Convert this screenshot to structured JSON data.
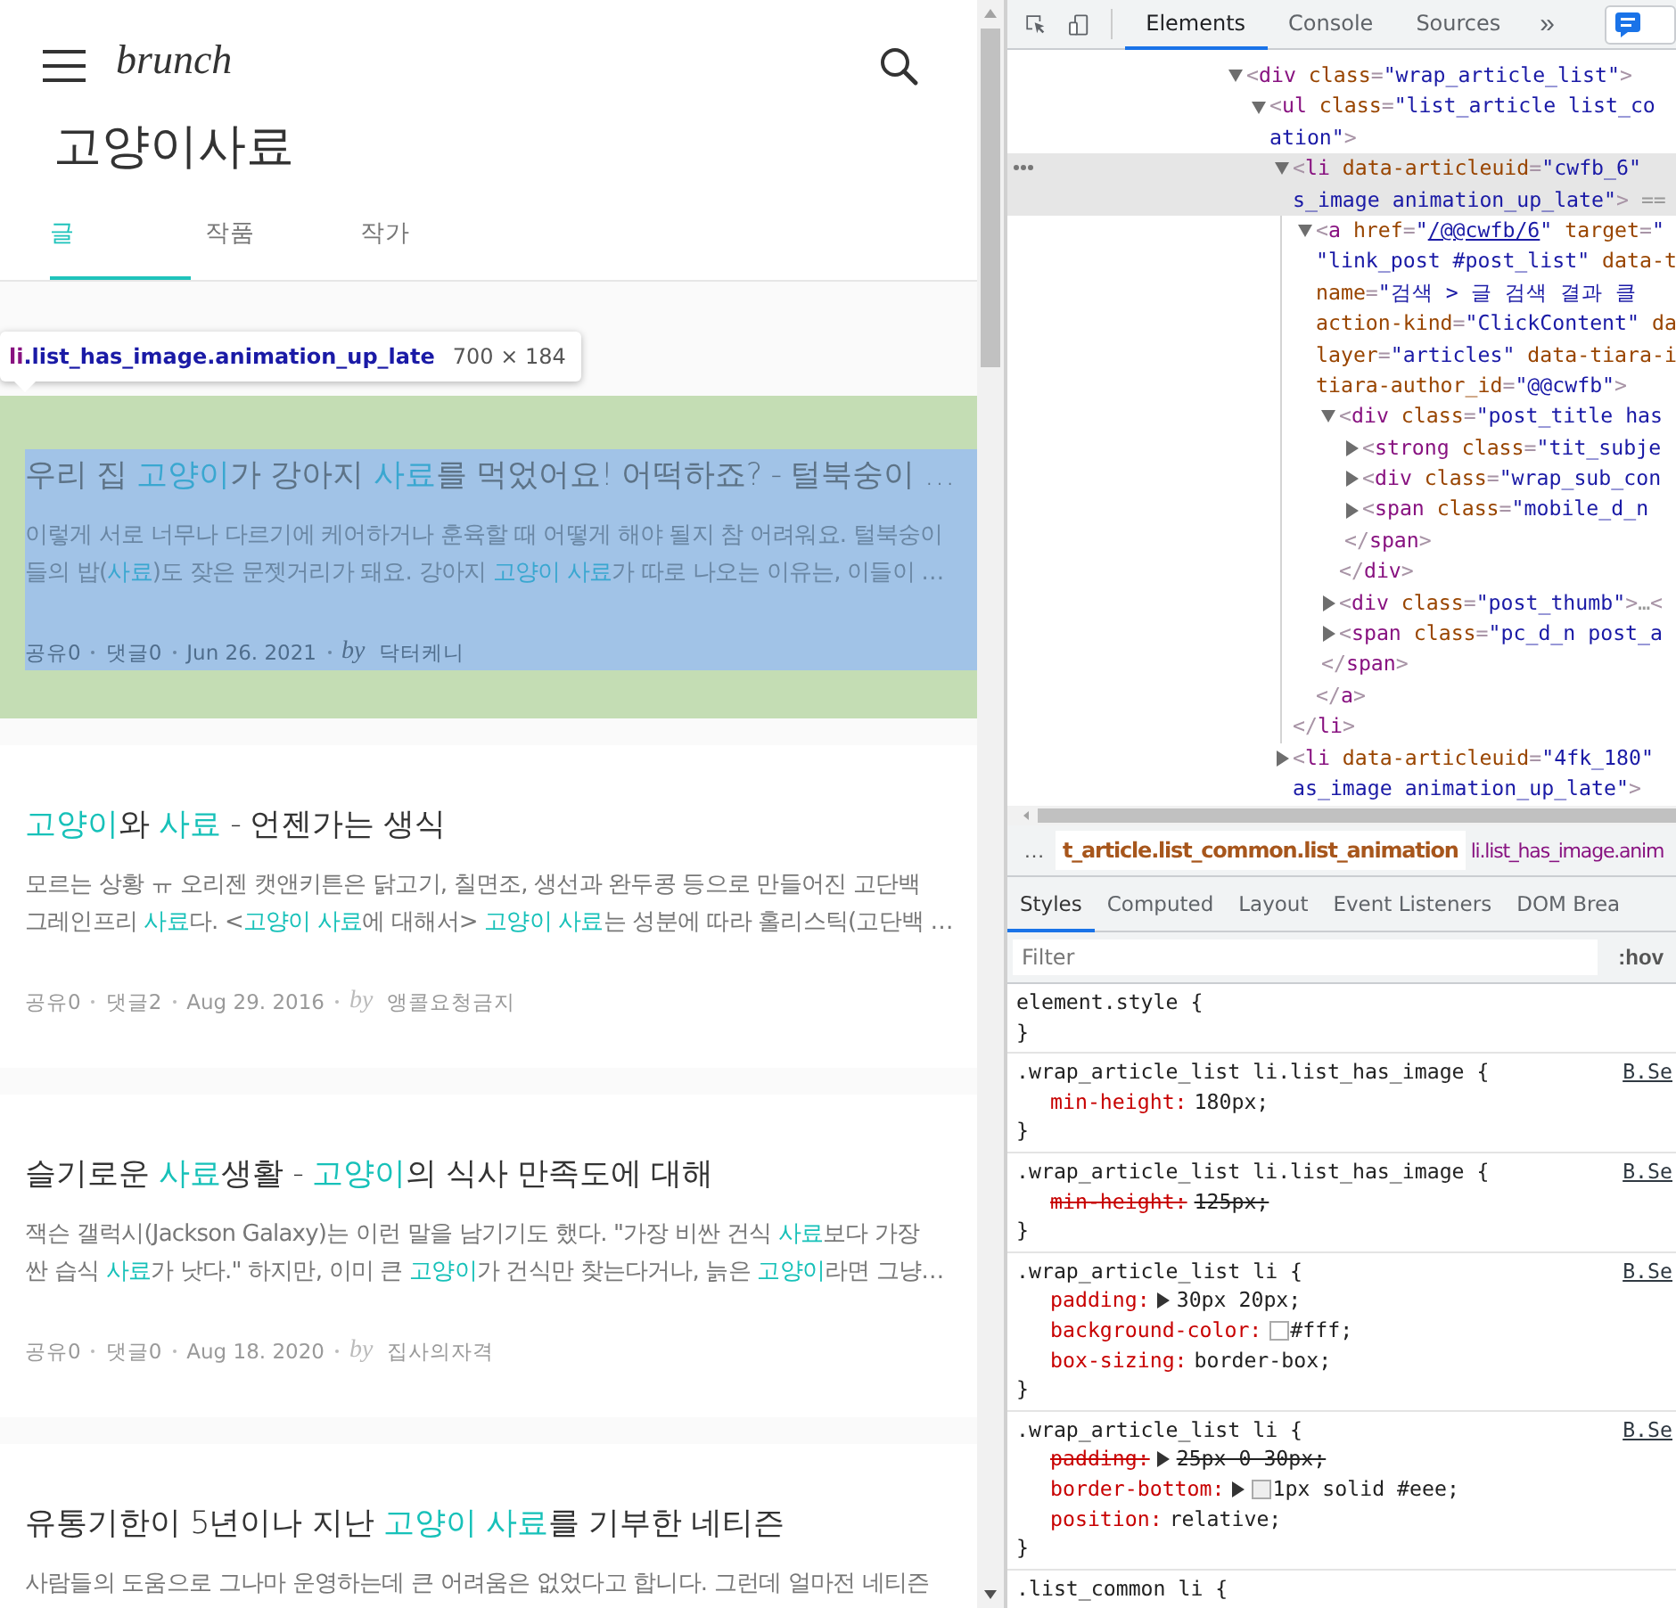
{
  "search_page": {
    "logo": "brunch",
    "query_title": "고양이사료",
    "tabs": [
      {
        "label": "글",
        "selected": true
      },
      {
        "label": "작품",
        "selected": false
      },
      {
        "label": "작가",
        "selected": false
      }
    ],
    "inspector_tooltip": {
      "tag": "li",
      "classes": ".list_has_image.animation_up_late",
      "size": "700 × 184"
    },
    "articles": [
      {
        "inspected": true,
        "title": [
          {
            "text": "우리 집 ",
            "match": false
          },
          {
            "text": "고양이",
            "match": true
          },
          {
            "text": "가 강아지 ",
            "match": false
          },
          {
            "text": "사료",
            "match": true
          },
          {
            "text": "를 먹었어요! 어떡하죠? - 털북숭이 …",
            "match": false
          }
        ],
        "excerpt": [
          [
            {
              "text": "이렇게 서로 너무나 다르기에 케어하거나 훈육할 때 어떻게 해야 될지 참 어려워요. 털북숭이",
              "match": false
            }
          ],
          [
            {
              "text": "들의 밥(",
              "match": false
            },
            {
              "text": "사료",
              "match": true
            },
            {
              "text": ")도 잦은 문젯거리가 돼요. 강아지 ",
              "match": false
            },
            {
              "text": "고양이 사료",
              "match": true
            },
            {
              "text": "가 따로 나오는 이유는, 이들이 …",
              "match": false
            }
          ]
        ],
        "meta": {
          "shares": "공유0",
          "comments": "댓글0",
          "date": "Jun 26. 2021",
          "by": "by",
          "author": "닥터케니"
        }
      },
      {
        "inspected": false,
        "title": [
          {
            "text": "고양이",
            "match": true
          },
          {
            "text": "와 ",
            "match": false
          },
          {
            "text": "사료",
            "match": true
          },
          {
            "text": " - 언젠가는 생식",
            "match": false
          }
        ],
        "excerpt": [
          [
            {
              "text": "모르는 상황 ㅠ 오리젠 캣앤키튼은 닭고기, 칠면조, 생선과 완두콩 등으로 만들어진 고단백",
              "match": false
            }
          ],
          [
            {
              "text": "그레인프리 ",
              "match": false
            },
            {
              "text": "사료",
              "match": true
            },
            {
              "text": "다. <",
              "match": false
            },
            {
              "text": "고양이 사료",
              "match": true
            },
            {
              "text": "에 대해서> ",
              "match": false
            },
            {
              "text": "고양이 사료",
              "match": true
            },
            {
              "text": "는 성분에 따라 홀리스틱(고단백 …",
              "match": false
            }
          ]
        ],
        "meta": {
          "shares": "공유0",
          "comments": "댓글2",
          "date": "Aug 29. 2016",
          "by": "by",
          "author": "앵콜요청금지"
        }
      },
      {
        "inspected": false,
        "title": [
          {
            "text": "슬기로운 ",
            "match": false
          },
          {
            "text": "사료",
            "match": true
          },
          {
            "text": "생활 - ",
            "match": false
          },
          {
            "text": "고양이",
            "match": true
          },
          {
            "text": "의 식사 만족도에 대해",
            "match": false
          }
        ],
        "excerpt": [
          [
            {
              "text": "잭슨 갤럭시(Jackson Galaxy)는 이런 말을 남기기도 했다. \"가장 비싼 건식 ",
              "match": false
            },
            {
              "text": "사료",
              "match": true
            },
            {
              "text": "보다 가장",
              "match": false
            }
          ],
          [
            {
              "text": "싼 습식 ",
              "match": false
            },
            {
              "text": "사료",
              "match": true
            },
            {
              "text": "가 낫다.\" 하지만, 이미 큰 ",
              "match": false
            },
            {
              "text": "고양이",
              "match": true
            },
            {
              "text": "가 건식만 찾는다거나, 늙은 ",
              "match": false
            },
            {
              "text": "고양이",
              "match": true
            },
            {
              "text": "라면 그냥…",
              "match": false
            }
          ]
        ],
        "meta": {
          "shares": "공유0",
          "comments": "댓글0",
          "date": "Aug 18. 2020",
          "by": "by",
          "author": "집사의자격"
        }
      },
      {
        "inspected": false,
        "title": [
          {
            "text": "유통기한이 5년이나 지난 ",
            "match": false
          },
          {
            "text": "고양이 사료",
            "match": true
          },
          {
            "text": "를 기부한 네티즌",
            "match": false
          }
        ],
        "excerpt": [
          [
            {
              "text": "사람들의 도움으로 그나마 운영하는데 큰 어려움은 없었다고 합니다. 그런데 얼마전 네티즌",
              "match": false
            }
          ]
        ]
      }
    ]
  },
  "devtools": {
    "panels": [
      {
        "label": "Elements",
        "selected": true
      },
      {
        "label": "Console",
        "selected": false
      },
      {
        "label": "Sources",
        "selected": false
      }
    ],
    "overflow": "»",
    "dom_tree": [
      {
        "expanded": true,
        "selected": false,
        "lines": [
          [
            {
              "kind": "punct",
              "text": "<"
            },
            {
              "kind": "tag",
              "text": "div"
            },
            {
              "kind": "attr",
              "text": " class"
            },
            {
              "kind": "punct",
              "text": "="
            },
            {
              "kind": "value",
              "text": "\"wrap_article_list\""
            },
            {
              "kind": "punct",
              "text": ">"
            }
          ]
        ],
        "children": [
          {
            "expanded": true,
            "selected": false,
            "lines": [
              [
                {
                  "kind": "punct",
                  "text": "<"
                },
                {
                  "kind": "tag",
                  "text": "ul"
                },
                {
                  "kind": "attr",
                  "text": " class"
                },
                {
                  "kind": "punct",
                  "text": "="
                },
                {
                  "kind": "value",
                  "text": "\"list_article list_co"
                }
              ],
              [
                {
                  "kind": "value",
                  "text": "ation\""
                },
                {
                  "kind": "punct",
                  "text": ">"
                }
              ]
            ],
            "children": [
              {
                "expanded": true,
                "selected": true,
                "lines": [
                  [
                    {
                      "kind": "punct",
                      "text": "<"
                    },
                    {
                      "kind": "tag",
                      "text": "li"
                    },
                    {
                      "kind": "attr",
                      "text": " data-articleuid"
                    },
                    {
                      "kind": "punct",
                      "text": "="
                    },
                    {
                      "kind": "value",
                      "text": "\"cwfb_6\""
                    }
                  ],
                  [
                    {
                      "kind": "value",
                      "text": "s_image animation_up_late\""
                    },
                    {
                      "kind": "punct",
                      "text": ">"
                    },
                    {
                      "kind": "note",
                      "text": " =="
                    }
                  ]
                ],
                "children": [
                  {
                    "expanded": true,
                    "selected": false,
                    "lines": [
                      [
                        {
                          "kind": "punct",
                          "text": "<"
                        },
                        {
                          "kind": "tag",
                          "text": "a"
                        },
                        {
                          "kind": "attr",
                          "text": " href"
                        },
                        {
                          "kind": "punct",
                          "text": "="
                        },
                        {
                          "kind": "value",
                          "text": "\""
                        },
                        {
                          "kind": "link",
                          "text": "/@@cwfb/6"
                        },
                        {
                          "kind": "value",
                          "text": "\""
                        },
                        {
                          "kind": "attr",
                          "text": " target"
                        },
                        {
                          "kind": "punct",
                          "text": "="
                        },
                        {
                          "kind": "value",
                          "text": "\""
                        }
                      ],
                      [
                        {
                          "kind": "value",
                          "text": "\"link_post #post_list\""
                        },
                        {
                          "kind": "attr",
                          "text": " data-t"
                        }
                      ],
                      [
                        {
                          "kind": "attr",
                          "text": "name"
                        },
                        {
                          "kind": "punct",
                          "text": "="
                        },
                        {
                          "kind": "value",
                          "text": "\"검색 > 글 검색 결과 클"
                        }
                      ],
                      [
                        {
                          "kind": "attr",
                          "text": "action-kind"
                        },
                        {
                          "kind": "punct",
                          "text": "="
                        },
                        {
                          "kind": "value",
                          "text": "\"ClickContent\""
                        },
                        {
                          "kind": "attr",
                          "text": " da"
                        }
                      ],
                      [
                        {
                          "kind": "attr",
                          "text": "layer"
                        },
                        {
                          "kind": "punct",
                          "text": "="
                        },
                        {
                          "kind": "value",
                          "text": "\"articles\""
                        },
                        {
                          "kind": "attr",
                          "text": " data-tiara-i"
                        }
                      ],
                      [
                        {
                          "kind": "attr",
                          "text": "tiara-author_id"
                        },
                        {
                          "kind": "punct",
                          "text": "="
                        },
                        {
                          "kind": "value",
                          "text": "\"@@cwfb\""
                        },
                        {
                          "kind": "punct",
                          "text": ">"
                        }
                      ]
                    ],
                    "children": [
                      {
                        "expanded": true,
                        "selected": false,
                        "lines": [
                          [
                            {
                              "kind": "punct",
                              "text": "<"
                            },
                            {
                              "kind": "tag",
                              "text": "div"
                            },
                            {
                              "kind": "attr",
                              "text": " class"
                            },
                            {
                              "kind": "punct",
                              "text": "="
                            },
                            {
                              "kind": "value",
                              "text": "\"post_title has"
                            }
                          ]
                        ],
                        "children": [
                          {
                            "expanded": false,
                            "selected": false,
                            "lines": [
                              [
                                {
                                  "kind": "punct",
                                  "text": "<"
                                },
                                {
                                  "kind": "tag",
                                  "text": "strong"
                                },
                                {
                                  "kind": "attr",
                                  "text": " class"
                                },
                                {
                                  "kind": "punct",
                                  "text": "="
                                },
                                {
                                  "kind": "value",
                                  "text": "\"tit_subje"
                                }
                              ]
                            ]
                          },
                          {
                            "expanded": false,
                            "selected": false,
                            "lines": [
                              [
                                {
                                  "kind": "punct",
                                  "text": "<"
                                },
                                {
                                  "kind": "tag",
                                  "text": "div"
                                },
                                {
                                  "kind": "attr",
                                  "text": " class"
                                },
                                {
                                  "kind": "punct",
                                  "text": "="
                                },
                                {
                                  "kind": "value",
                                  "text": "\"wrap_sub_con"
                                }
                              ]
                            ]
                          },
                          {
                            "expanded": false,
                            "selected": false,
                            "lines": [
                              [
                                {
                                  "kind": "punct",
                                  "text": "<"
                                },
                                {
                                  "kind": "tag",
                                  "text": "span"
                                },
                                {
                                  "kind": "attr",
                                  "text": " class"
                                },
                                {
                                  "kind": "punct",
                                  "text": "="
                                },
                                {
                                  "kind": "value",
                                  "text": "\"mobile_d_n"
                                }
                              ]
                            ],
                            "closing": [
                              {
                                "kind": "punct",
                                "text": "</"
                              },
                              {
                                "kind": "tag",
                                "text": "span"
                              },
                              {
                                "kind": "punct",
                                "text": ">"
                              }
                            ]
                          }
                        ],
                        "closing": [
                          {
                            "kind": "punct",
                            "text": "</"
                          },
                          {
                            "kind": "tag",
                            "text": "div"
                          },
                          {
                            "kind": "punct",
                            "text": ">"
                          }
                        ]
                      },
                      {
                        "expanded": false,
                        "selected": false,
                        "lines": [
                          [
                            {
                              "kind": "punct",
                              "text": "<"
                            },
                            {
                              "kind": "tag",
                              "text": "div"
                            },
                            {
                              "kind": "attr",
                              "text": " class"
                            },
                            {
                              "kind": "punct",
                              "text": "="
                            },
                            {
                              "kind": "value",
                              "text": "\"post_thumb\""
                            },
                            {
                              "kind": "punct",
                              "text": ">"
                            },
                            {
                              "kind": "note",
                              "text": "…"
                            },
                            {
                              "kind": "punct",
                              "text": "<"
                            }
                          ]
                        ]
                      },
                      {
                        "expanded": false,
                        "selected": false,
                        "lines": [
                          [
                            {
                              "kind": "punct",
                              "text": "<"
                            },
                            {
                              "kind": "tag",
                              "text": "span"
                            },
                            {
                              "kind": "attr",
                              "text": " class"
                            },
                            {
                              "kind": "punct",
                              "text": "="
                            },
                            {
                              "kind": "value",
                              "text": "\"pc_d_n post_a"
                            }
                          ]
                        ],
                        "closing": [
                          {
                            "kind": "punct",
                            "text": "</"
                          },
                          {
                            "kind": "tag",
                            "text": "span"
                          },
                          {
                            "kind": "punct",
                            "text": ">"
                          }
                        ]
                      }
                    ],
                    "closing": [
                      {
                        "kind": "punct",
                        "text": "</"
                      },
                      {
                        "kind": "tag",
                        "text": "a"
                      },
                      {
                        "kind": "punct",
                        "text": ">"
                      }
                    ]
                  }
                ],
                "closing": [
                  {
                    "kind": "punct",
                    "text": "</"
                  },
                  {
                    "kind": "tag",
                    "text": "li"
                  },
                  {
                    "kind": "punct",
                    "text": ">"
                  }
                ]
              },
              {
                "expanded": false,
                "selected": false,
                "lines": [
                  [
                    {
                      "kind": "punct",
                      "text": "<"
                    },
                    {
                      "kind": "tag",
                      "text": "li"
                    },
                    {
                      "kind": "attr",
                      "text": " data-articleuid"
                    },
                    {
                      "kind": "punct",
                      "text": "="
                    },
                    {
                      "kind": "value",
                      "text": "\"4fk_180\""
                    }
                  ],
                  [
                    {
                      "kind": "value",
                      "text": "as_image animation_up_late\""
                    },
                    {
                      "kind": "punct",
                      "text": ">"
                    }
                  ]
                ]
              }
            ]
          }
        ]
      }
    ],
    "more_crumbs": "…",
    "breadcrumbs": [
      {
        "text": "t_article.list_common.list_animation",
        "hovered": true
      },
      {
        "text": "li.list_has_image.anim",
        "hovered": false
      }
    ],
    "style_tabs": [
      {
        "label": "Styles",
        "selected": true
      },
      {
        "label": "Computed",
        "selected": false
      },
      {
        "label": "Layout",
        "selected": false
      },
      {
        "label": "Event Listeners",
        "selected": false
      },
      {
        "label": "DOM Brea",
        "selected": false
      }
    ],
    "filter": {
      "placeholder": "Filter",
      "hov": ":hov"
    },
    "rules": [
      {
        "selector": "element.style {",
        "close": "}"
      },
      {
        "selector": ".wrap_article_list li.list_has_image {",
        "source": "B.Se",
        "close": "}",
        "declarations": [
          {
            "property": "min-height:",
            "value": "180px;",
            "struck": false,
            "expandable": false
          }
        ]
      },
      {
        "selector": ".wrap_article_list li.list_has_image {",
        "source": "B.Se",
        "close": "}",
        "declarations": [
          {
            "property": "min-height:",
            "value": "125px;",
            "struck": true,
            "expandable": false
          }
        ]
      },
      {
        "selector": ".wrap_article_list li {",
        "source": "B.Se",
        "close": "}",
        "declarations": [
          {
            "property": "padding:",
            "value": "30px 20px;",
            "struck": false,
            "expandable": true
          },
          {
            "property": "background-color:",
            "value": "#fff;",
            "struck": false,
            "expandable": false,
            "color": "#ffffff"
          },
          {
            "property": "box-sizing:",
            "value": "border-box;",
            "struck": false,
            "expandable": false
          }
        ]
      },
      {
        "selector": ".wrap_article_list li {",
        "source": "B.Se",
        "close": "}",
        "declarations": [
          {
            "property": "padding:",
            "value": "25px 0 30px;",
            "struck": true,
            "expandable": true
          },
          {
            "property": "border-bottom:",
            "value": "1px solid #eee;",
            "struck": false,
            "expandable": true,
            "color": "#eeeeee"
          },
          {
            "property": "position:",
            "value": "relative;",
            "struck": false,
            "expandable": false
          }
        ]
      },
      {
        "selector": ".list_common li {"
      }
    ]
  }
}
